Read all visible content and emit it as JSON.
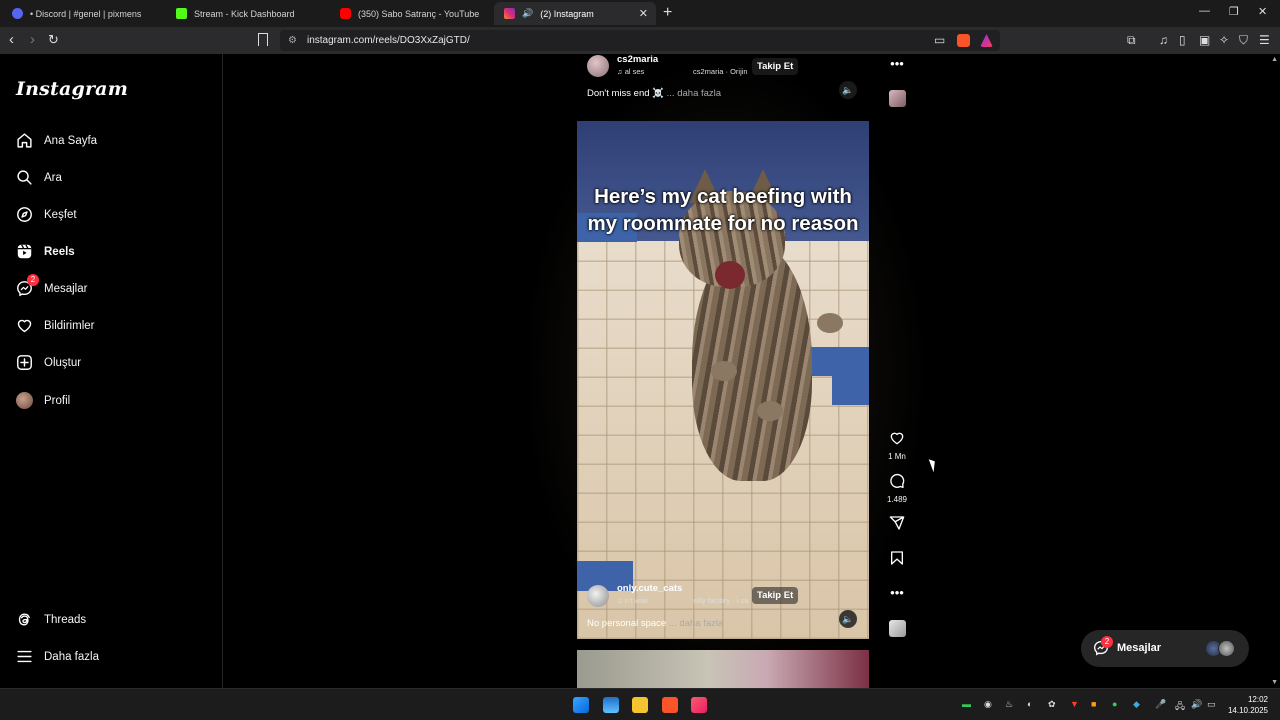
{
  "browser": {
    "tabs": [
      {
        "label": "• Discord | #genel | pixmens",
        "favicon_color": "#5865f2"
      },
      {
        "label": "Stream - Kick Dashboard",
        "favicon_color": "#53fc18"
      },
      {
        "label": "(350) Sabo Satranç - YouTube",
        "favicon_color": "#ff0000"
      },
      {
        "label": "(2) Instagram",
        "favicon_color": "#d62976",
        "active": true
      }
    ],
    "url": "instagram.com/reels/DO3XxZajGTD/"
  },
  "sidebar": {
    "logo": "Instagram",
    "items": [
      {
        "label": "Ana Sayfa",
        "icon": "home-icon"
      },
      {
        "label": "Ara",
        "icon": "search-icon"
      },
      {
        "label": "Keşfet",
        "icon": "explore-icon"
      },
      {
        "label": "Reels",
        "icon": "reels-icon",
        "active": true
      },
      {
        "label": "Mesajlar",
        "icon": "messenger-icon",
        "badge": "2"
      },
      {
        "label": "Bildirimler",
        "icon": "heart-icon"
      },
      {
        "label": "Oluştur",
        "icon": "plus-square-icon"
      },
      {
        "label": "Profil",
        "icon": "avatar"
      }
    ],
    "bottom": [
      {
        "label": "Threads",
        "icon": "threads-icon"
      },
      {
        "label": "Daha fazla",
        "icon": "menu-icon"
      }
    ]
  },
  "reel_top": {
    "username": "cs2maria",
    "audio": "al ses",
    "original_audio": "cs2maria · Orijin",
    "follow": "Takip Et",
    "caption": "Don't miss end ☠️",
    "more": "... daha fazla"
  },
  "reel_main": {
    "overlay_text": "Here’s my cat beefing with my roommate for no reason",
    "username": "only.cute_cats",
    "audio": "n't wait",
    "original_audio": "silly factory · i ca",
    "follow": "Takip Et",
    "caption": "No personal space",
    "more": "... daha fazla"
  },
  "actions": {
    "likes": "1 Mn",
    "comments": "1.489"
  },
  "messages_pill": {
    "label": "Mesajlar",
    "badge": "2"
  },
  "taskbar": {
    "time": "12:02",
    "date": "14.10.2025"
  }
}
